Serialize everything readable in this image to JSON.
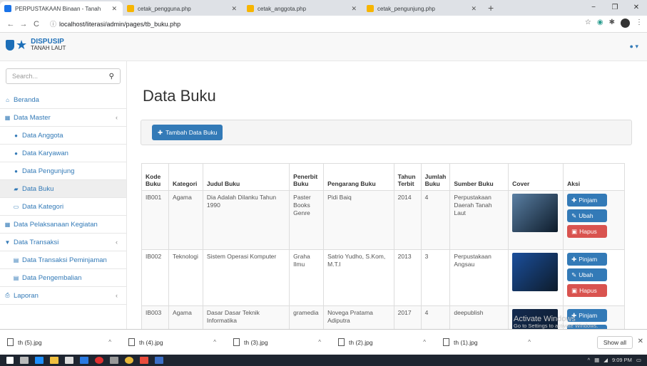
{
  "browser": {
    "tabs": [
      {
        "label": "PERPUSTAKAAN Binaan - Tanah",
        "color": "#1a73e8"
      },
      {
        "label": "cetak_pengguna.php",
        "color": "#f7b500"
      },
      {
        "label": "cetak_anggota.php",
        "color": "#f7b500"
      },
      {
        "label": "cetak_pengunjung.php",
        "color": "#f7b500"
      }
    ],
    "new_tab": "+",
    "url": "localhost/literasi/admin/pages/tb_buku.php",
    "window_controls": [
      "−",
      "❐",
      "✕"
    ]
  },
  "app": {
    "logo_line1": "DISPUSIP",
    "logo_line2": "TANAH LAUT",
    "user_menu": "▾"
  },
  "sidebar": {
    "search_placeholder": "Search...",
    "items": [
      {
        "label": "Beranda",
        "icon": "home-icon",
        "glyph": "⌂",
        "sub": false
      },
      {
        "label": "Data Master",
        "icon": "grid-icon",
        "glyph": "▦",
        "sub": false,
        "caret": "‹"
      },
      {
        "label": "Data Anggota",
        "icon": "user-icon",
        "glyph": "●",
        "sub": true
      },
      {
        "label": "Data Karyawan",
        "icon": "user-icon",
        "glyph": "●",
        "sub": true
      },
      {
        "label": "Data Pengunjung",
        "icon": "users-icon",
        "glyph": "●",
        "sub": true
      },
      {
        "label": "Data Buku",
        "icon": "book-icon",
        "glyph": "▰",
        "sub": true,
        "selected": true
      },
      {
        "label": "Data Kategori",
        "icon": "folder-icon",
        "glyph": "▭",
        "sub": true
      },
      {
        "label": "Data Pelaksanaan Kegiatan",
        "icon": "grid-icon",
        "glyph": "▦",
        "sub": false
      },
      {
        "label": "Data Transaksi",
        "icon": "cart-icon",
        "glyph": "▼",
        "sub": false,
        "caret": "‹"
      },
      {
        "label": "Data Transaksi Peminjaman",
        "icon": "table-icon",
        "glyph": "▤",
        "sub": true
      },
      {
        "label": "Data Pengembalian",
        "icon": "table-icon",
        "glyph": "▤",
        "sub": true
      },
      {
        "label": "Laporan",
        "icon": "print-icon",
        "glyph": "⎙",
        "sub": false,
        "caret": "‹"
      }
    ]
  },
  "main": {
    "title": "Data Buku",
    "add_button": "Tambah Data Buku",
    "columns": [
      "Kode Buku",
      "Kategori",
      "Judul Buku",
      "Penerbit Buku",
      "Pengarang Buku",
      "Tahun Terbit",
      "Jumlah Buku",
      "Sumber Buku",
      "Cover",
      "Aksi"
    ],
    "rows": [
      {
        "kode": "IB001",
        "kategori": "Agama",
        "judul": "Dia Adalah Dilanku Tahun 1990",
        "penerbit": "Paster Books Genre",
        "pengarang": "Pidi Baiq",
        "tahun": "2014",
        "jumlah": "4",
        "sumber": "Perpustakaan Daerah Tanah Laut",
        "cover_color": "#5a7fa3"
      },
      {
        "kode": "IB002",
        "kategori": "Teknologi",
        "judul": "Sistem Operasi Komputer",
        "penerbit": "Graha Ilmu",
        "pengarang": "Satrio Yudho, S.Kom, M.T.I",
        "tahun": "2013",
        "jumlah": "3",
        "sumber": "Perpustakaan Angsau",
        "cover_color": "#1b4f9c"
      },
      {
        "kode": "IB003",
        "kategori": "Agama",
        "judul": "Dasar Dasar Teknik Informatika",
        "penerbit": "gramedia",
        "pengarang": "Novega Pratama Adiputra",
        "tahun": "2017",
        "jumlah": "4",
        "sumber": "deepublish",
        "cover_color": "#132a4f"
      }
    ],
    "actions": {
      "pinjam": "Pinjam",
      "ubah": "Ubah",
      "hapus": "Hapus"
    }
  },
  "downloads": {
    "files": [
      "th (5).jpg",
      "th (4).jpg",
      "th (3).jpg",
      "th (2).jpg",
      "th (1).jpg"
    ],
    "show_all": "Show all"
  },
  "watermark": {
    "line1": "Activate Windows",
    "line2": "Go to Settings to activate Windows."
  },
  "taskbar": {
    "time": "9:09 PM"
  }
}
